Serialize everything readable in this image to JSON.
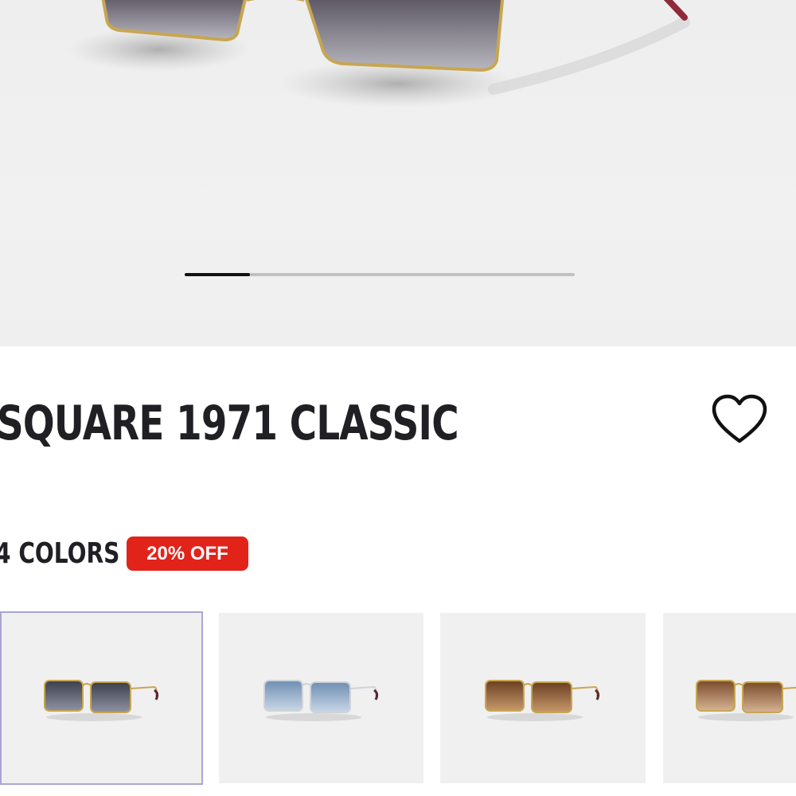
{
  "product": {
    "title": "SQUARE 1971 CLASSIC",
    "colors_label": "4 COLORS",
    "discount_badge": "20% OFF"
  },
  "carousel": {
    "progress": 0.167
  },
  "wishlist": {
    "icon": "heart-outline-icon"
  },
  "swatches": [
    {
      "lens_color": "#3c3f4c",
      "lens_color_light": "#8e93a3",
      "frame_color": "#c7a651",
      "selected": true
    },
    {
      "lens_color": "#6f8fb3",
      "lens_color_light": "#c9d6e6",
      "frame_color": "#cfd3d8",
      "selected": false
    },
    {
      "lens_color": "#6a4022",
      "lens_color_light": "#c8996b",
      "frame_color": "#c7a651",
      "selected": false
    },
    {
      "lens_color": "#7a4b2b",
      "lens_color_light": "#d6b494",
      "frame_color": "#c7a651",
      "selected": false
    }
  ],
  "colors": {
    "badge": "#e2231a",
    "title_text": "#1f1f24",
    "hero_bg": "#efefef",
    "swatch_bg": "#f0f0f0",
    "selected_outline": "#a9a6d4"
  }
}
